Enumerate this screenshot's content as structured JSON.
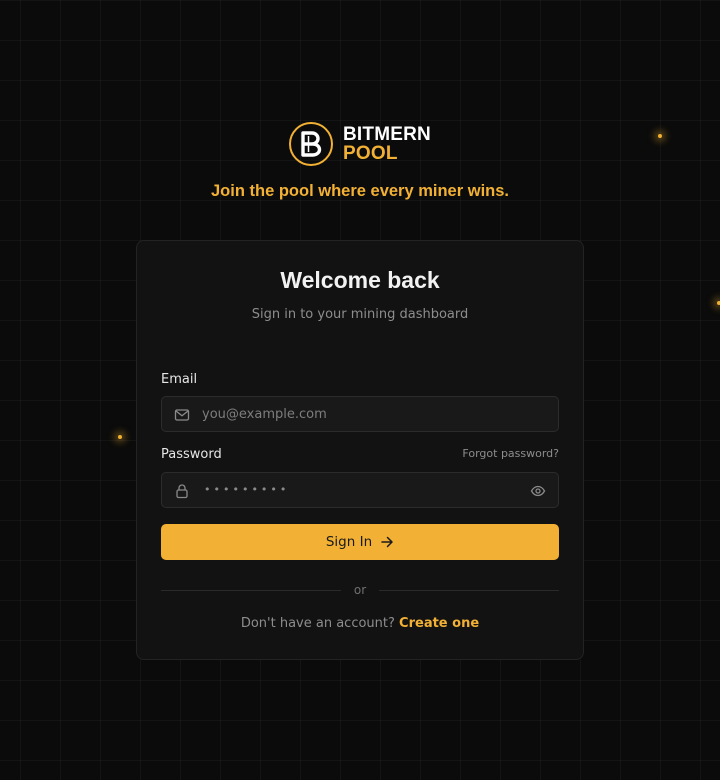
{
  "brand": {
    "name_line1": "BITMERN",
    "name_line2": "POOL",
    "logo_letter": "B",
    "accent_color": "#f2b134"
  },
  "tagline": "Join the pool where every miner wins.",
  "card": {
    "title": "Welcome back",
    "subtitle": "Sign in to your mining dashboard"
  },
  "form": {
    "email_label": "Email",
    "email_placeholder": "you@example.com",
    "email_icon": "mail-icon",
    "password_label": "Password",
    "password_value_masked": "•••••••••",
    "password_icon": "lock-icon",
    "show_password_icon": "eye-icon",
    "forgot_label": "Forgot password?",
    "submit_label": "Sign In",
    "submit_icon": "arrow-right-icon"
  },
  "divider_text": "or",
  "footer": {
    "prompt": "Don't have an account?",
    "link_label": "Create one"
  }
}
